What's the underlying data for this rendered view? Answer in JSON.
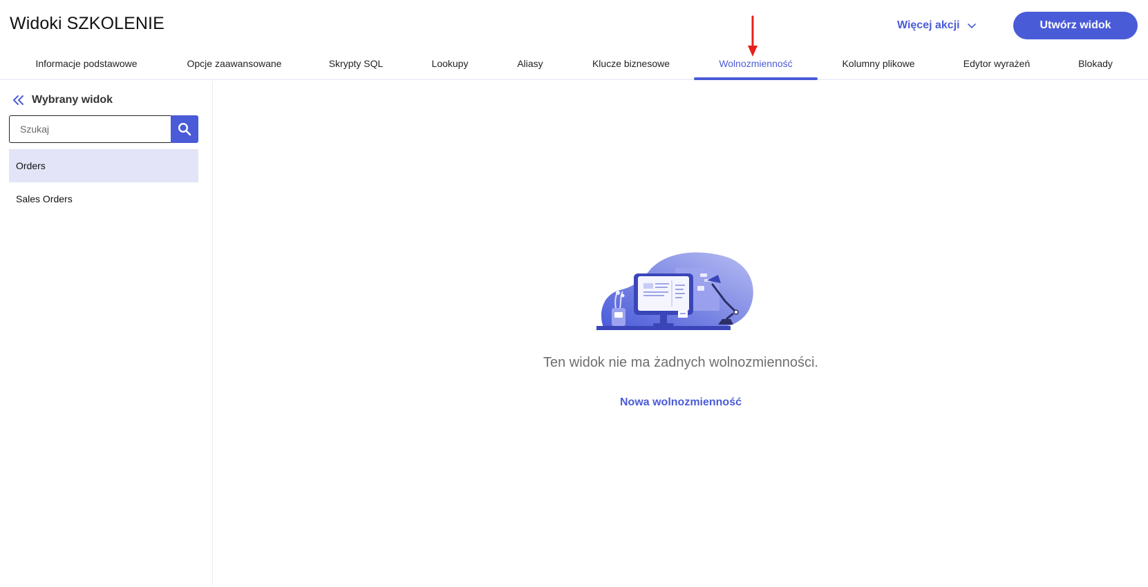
{
  "page": {
    "title": "Widoki SZKOLENIE"
  },
  "header": {
    "more_actions_label": "Więcej akcji",
    "create_button_label": "Utwórz widok"
  },
  "tabs": [
    {
      "label": "Informacje podstawowe",
      "active": false
    },
    {
      "label": "Opcje zaawansowane",
      "active": false
    },
    {
      "label": "Skrypty SQL",
      "active": false
    },
    {
      "label": "Lookupy",
      "active": false
    },
    {
      "label": "Aliasy",
      "active": false
    },
    {
      "label": "Klucze biznesowe",
      "active": false
    },
    {
      "label": "Wolnozmienność",
      "active": true
    },
    {
      "label": "Kolumny plikowe",
      "active": false
    },
    {
      "label": "Edytor wyrażeń",
      "active": false
    },
    {
      "label": "Blokady",
      "active": false
    }
  ],
  "sidebar": {
    "title": "Wybrany widok",
    "search_placeholder": "Szukaj",
    "search_value": "",
    "items": [
      {
        "label": "Orders",
        "selected": true
      },
      {
        "label": "Sales Orders",
        "selected": false
      }
    ]
  },
  "main": {
    "empty_message": "Ten widok nie ma żadnych wolnozmienności.",
    "new_link_label": "Nowa wolnozmienność"
  },
  "colors": {
    "accent": "#4a5bd8",
    "selected_row_bg": "#e3e4f7",
    "annotation_arrow": "#e8201a"
  },
  "icons": {
    "collapse": "double-chevron-left-icon",
    "search": "search-icon",
    "dropdown": "chevron-down-icon"
  }
}
